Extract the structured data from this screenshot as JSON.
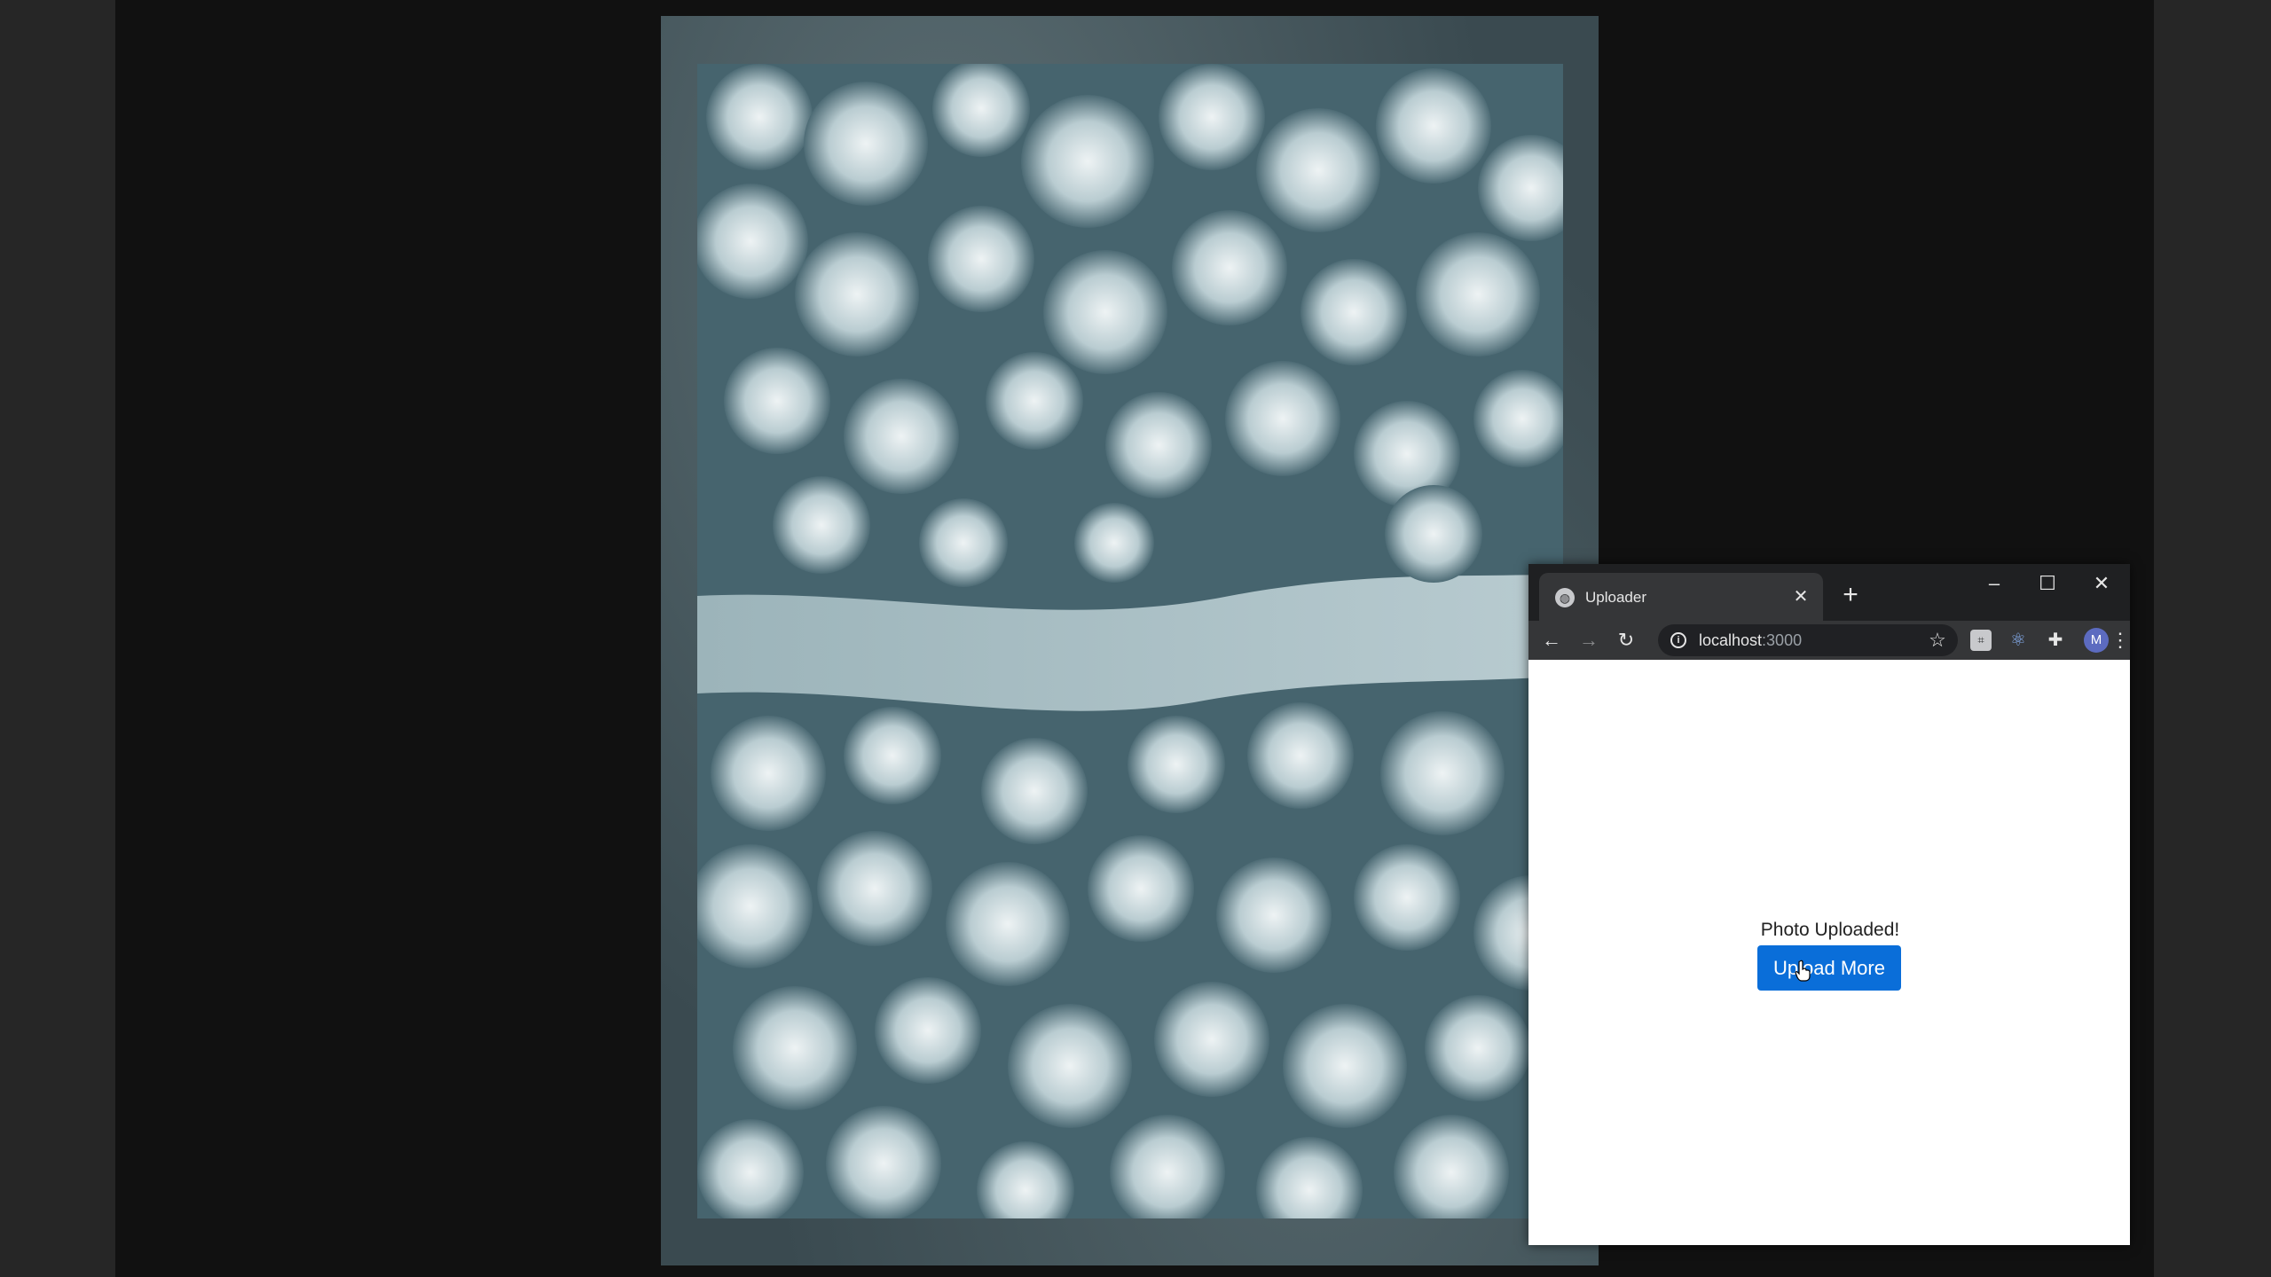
{
  "browser": {
    "tab_title": "Uploader",
    "tab_close": "✕",
    "new_tab": "+",
    "window_controls": {
      "minimize": "–",
      "maximize": "☐",
      "close": "✕"
    },
    "nav": {
      "back": "←",
      "forward": "→",
      "reload": "↻"
    },
    "url_host": "localhost",
    "url_port": ":3000",
    "avatar_letter": "M",
    "icons": [
      "globe-icon",
      "info-icon",
      "star-icon",
      "extension-icon",
      "puzzle-icon",
      "menu-icon"
    ]
  },
  "page": {
    "status": "Photo Uploaded!",
    "button_label": "Upload More"
  },
  "colors": {
    "button": "#0a6ed9",
    "chrome_dark": "#1f2022",
    "chrome_tab": "#353638"
  }
}
